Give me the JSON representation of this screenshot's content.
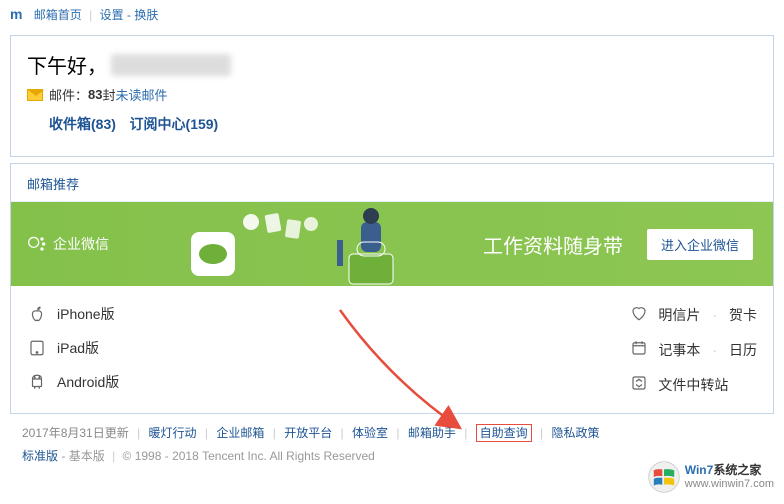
{
  "topnav": {
    "logo_suffix": "m",
    "home": "邮箱首页",
    "settings": "设置",
    "skin": "换肤"
  },
  "greeting": "下午好，",
  "mail_line": {
    "prefix": "邮件：",
    "count": "83",
    "suffix": " 封",
    "unread": "未读邮件"
  },
  "folders": {
    "inbox": "收件箱(83)",
    "sub": "订阅中心(159)"
  },
  "recommend_header": "邮箱推荐",
  "banner": {
    "wework": "企业微信",
    "slogan": "工作资料随身带",
    "enter": "进入企业微信"
  },
  "platforms": {
    "iphone": "iPhone版",
    "ipad": "iPad版",
    "android": "Android版"
  },
  "right_items": {
    "postcard": "明信片",
    "greeting_card": "贺卡",
    "notebook": "记事本",
    "calendar": "日历",
    "transfer": "文件中转站"
  },
  "footer": {
    "update": "2017年8月31日更新",
    "links": [
      "暖灯行动",
      "企业邮箱",
      "开放平台",
      "体验室",
      "邮箱助手",
      "自助查询",
      "隐私政策"
    ],
    "standard": "标准版",
    "basic": "基本版",
    "copyright": "© 1998 - 2018 Tencent Inc. All Rights Reserved"
  },
  "watermark": {
    "brand1": "Win7",
    "brand2": "系统之家",
    "url": "www.winwin7.com"
  }
}
